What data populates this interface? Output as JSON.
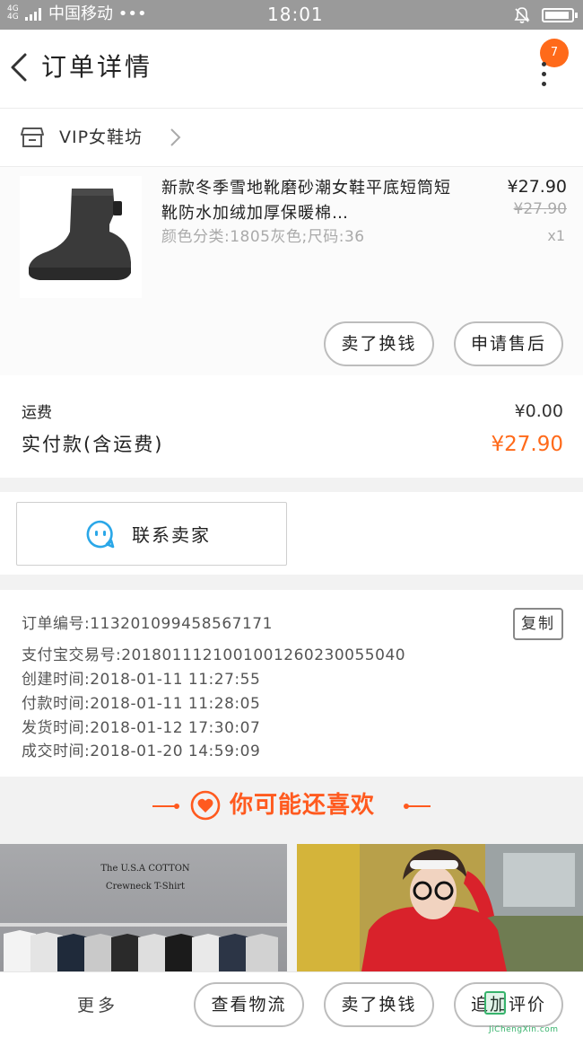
{
  "status_bar": {
    "network": "4G 4G",
    "carrier": "中国移动 •••",
    "time": "18:01"
  },
  "header": {
    "title": "订单详情",
    "badge_count": "7"
  },
  "shop": {
    "name": "VIP女鞋坊"
  },
  "product": {
    "title": "新款冬季雪地靴磨砂潮女鞋平底短筒短靴防水加绒加厚保暖棉…",
    "sku": "颜色分类:1805灰色;尺码:36",
    "price": "¥27.90",
    "original_price": "¥27.90",
    "quantity": "x1",
    "actions": {
      "sell": "卖了换钱",
      "after_sale": "申请售后"
    }
  },
  "amounts": {
    "shipping_label": "运费",
    "shipping_value": "¥0.00",
    "paid_label": "实付款(含运费)",
    "paid_value": "¥27.90"
  },
  "contact": {
    "label": "联系卖家"
  },
  "order_info": {
    "order_no": "订单编号:113201099458567171",
    "alipay_no": "支付宝交易号:2018011121001001260230055040",
    "created": "创建时间:2018-01-11  11:27:55",
    "paid": "付款时间:2018-01-11  11:28:05",
    "shipped": "发货时间:2018-01-12  17:30:07",
    "completed": "成交时间:2018-01-20  14:59:09",
    "copy_label": "复制"
  },
  "recommend": {
    "title": "你可能还喜欢",
    "card_left_sign_1": "The U.S.A COTTON",
    "card_left_sign_2": "Crewneck T-Shirt"
  },
  "bottom_bar": {
    "more": "更多",
    "logistics": "查看物流",
    "sell": "卖了换钱",
    "review": "追加评价"
  },
  "watermark": {
    "text": "JiChengXin.com"
  },
  "colors": {
    "accent": "#ff6a1a",
    "recommend": "#ff5a1f",
    "status_bar": "#9a9a9a"
  },
  "icons": [
    "back-arrow-icon",
    "more-vertical-icon",
    "shop-icon",
    "chevron-right-icon",
    "chat-bubble-icon",
    "heart-icon",
    "bell-icon",
    "battery-icon",
    "signal-icon"
  ]
}
